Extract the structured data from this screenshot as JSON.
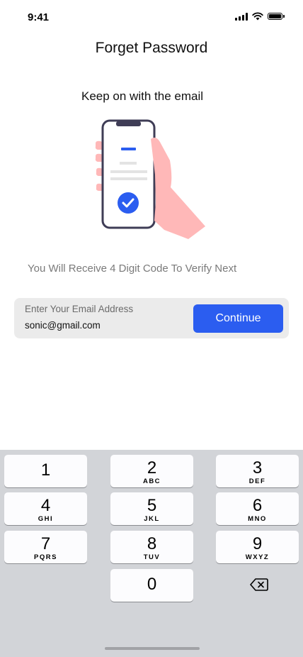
{
  "status_bar": {
    "time": "9:41"
  },
  "header": {
    "title": "Forget Password"
  },
  "main": {
    "subtitle": "Keep on with the email",
    "hint": "You Will Receive 4 Digit Code To Verify Next",
    "email_field": {
      "label": "Enter Your Email Address",
      "value": "sonic@gmail.com"
    },
    "continue_label": "Continue"
  },
  "colors": {
    "accent": "#2b5df0",
    "hand": "#ffb8b8",
    "phone_frame": "#3f3d56"
  },
  "keyboard": {
    "keys": [
      {
        "digit": "1",
        "letters": ""
      },
      {
        "digit": "2",
        "letters": "ABC"
      },
      {
        "digit": "3",
        "letters": "DEF"
      },
      {
        "digit": "4",
        "letters": "GHI"
      },
      {
        "digit": "5",
        "letters": "JKL"
      },
      {
        "digit": "6",
        "letters": "MNO"
      },
      {
        "digit": "7",
        "letters": "PQRS"
      },
      {
        "digit": "8",
        "letters": "TUV"
      },
      {
        "digit": "9",
        "letters": "WXYZ"
      },
      {
        "digit": "0",
        "letters": ""
      }
    ],
    "delete_icon": "backspace-icon"
  }
}
